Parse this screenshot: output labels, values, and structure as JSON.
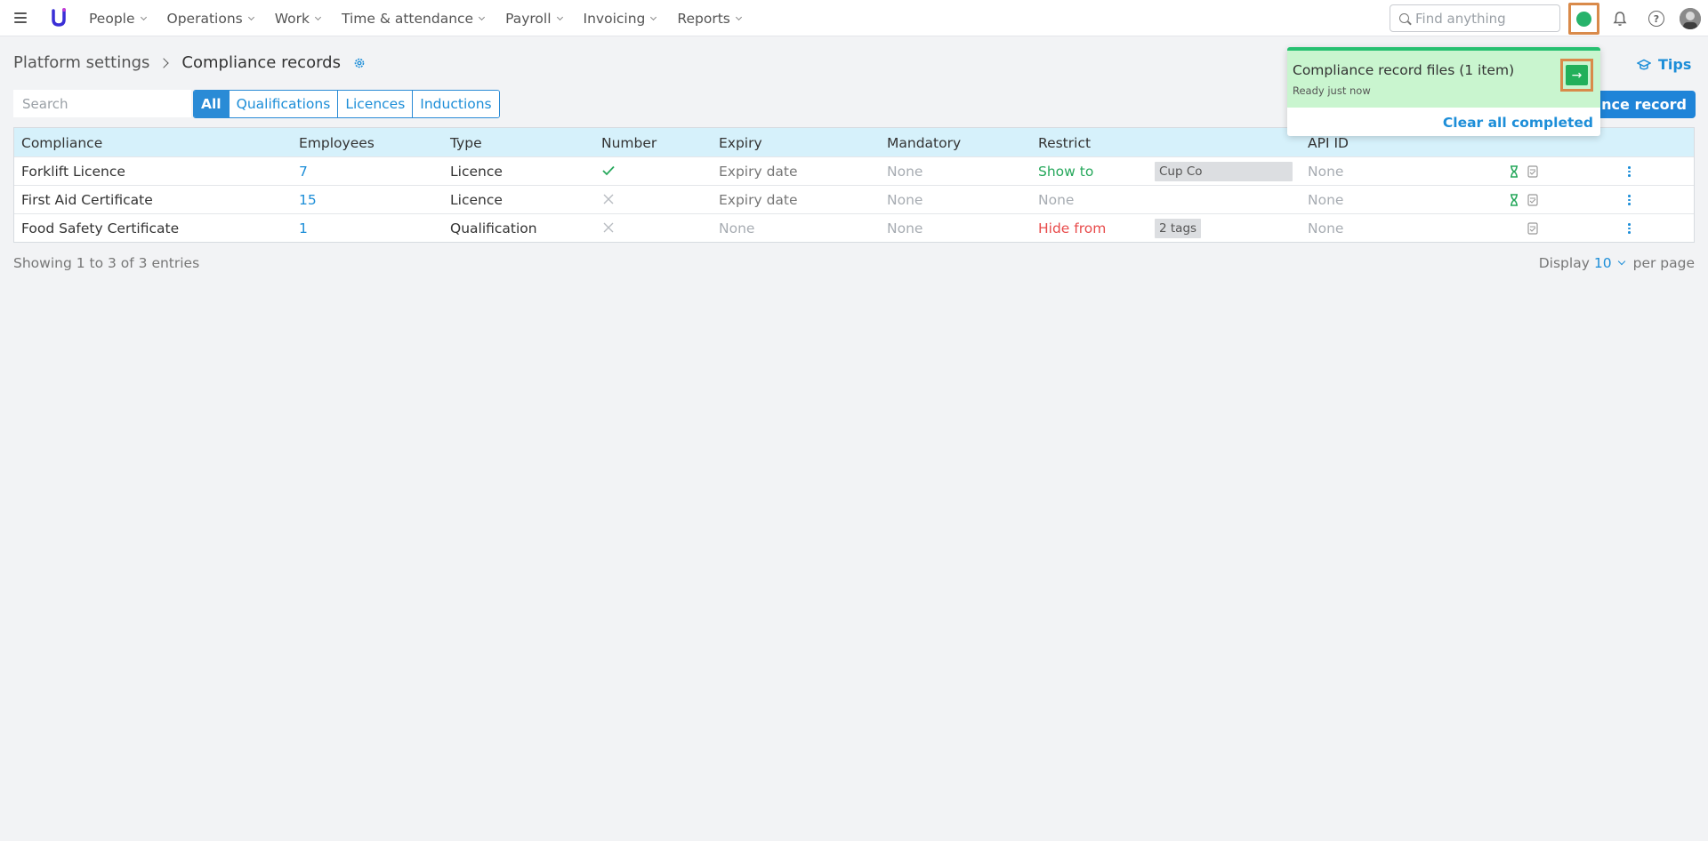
{
  "nav": {
    "items": [
      {
        "label": "People"
      },
      {
        "label": "Operations"
      },
      {
        "label": "Work"
      },
      {
        "label": "Time & attendance"
      },
      {
        "label": "Payroll"
      },
      {
        "label": "Invoicing"
      },
      {
        "label": "Reports"
      }
    ],
    "search_placeholder": "Find anything",
    "help_label": "?"
  },
  "breadcrumb": {
    "parent": "Platform settings",
    "current": "Compliance records"
  },
  "tips_label": "Tips",
  "search_placeholder": "Search",
  "filters": [
    {
      "label": "All",
      "active": true
    },
    {
      "label": "Qualifications",
      "active": false
    },
    {
      "label": "Licences",
      "active": false
    },
    {
      "label": "Inductions",
      "active": false
    }
  ],
  "add_button_label": "liance record",
  "table": {
    "headers": {
      "compliance": "Compliance",
      "employees": "Employees",
      "type": "Type",
      "number": "Number",
      "expiry": "Expiry",
      "mandatory": "Mandatory",
      "restrict": "Restrict",
      "api_id": "API ID"
    },
    "rows": [
      {
        "compliance": "Forklift Licence",
        "employees": "7",
        "type": "Licence",
        "number": "check",
        "expiry": "Expiry date",
        "mandatory": "None",
        "restrict": "Show to",
        "tag": "Cup Co",
        "api_id": "None",
        "hourglass": true
      },
      {
        "compliance": "First Aid Certificate",
        "employees": "15",
        "type": "Licence",
        "number": "cross",
        "expiry": "Expiry date",
        "mandatory": "None",
        "restrict": "None",
        "tag": "",
        "api_id": "None",
        "hourglass": true
      },
      {
        "compliance": "Food Safety Certificate",
        "employees": "1",
        "type": "Qualification",
        "number": "cross",
        "expiry": "None",
        "mandatory": "None",
        "restrict": "Hide from",
        "tag": "2 tags",
        "api_id": "None",
        "hourglass": false
      }
    ]
  },
  "footer": {
    "showing": "Showing 1 to 3 of 3 entries",
    "display_label": "Display",
    "per_page_value": "10",
    "per_page_suffix": "per page"
  },
  "popup": {
    "title": "Compliance record files (1 item)",
    "subtitle": "Ready just now",
    "clear_label": "Clear all completed",
    "go_icon": "→"
  },
  "colors": {
    "accent": "#1d8ed8",
    "success": "#27b36b",
    "danger": "#e84b4b",
    "header_bg": "#d6f1fb",
    "popup_bg": "#c9f5cf"
  }
}
